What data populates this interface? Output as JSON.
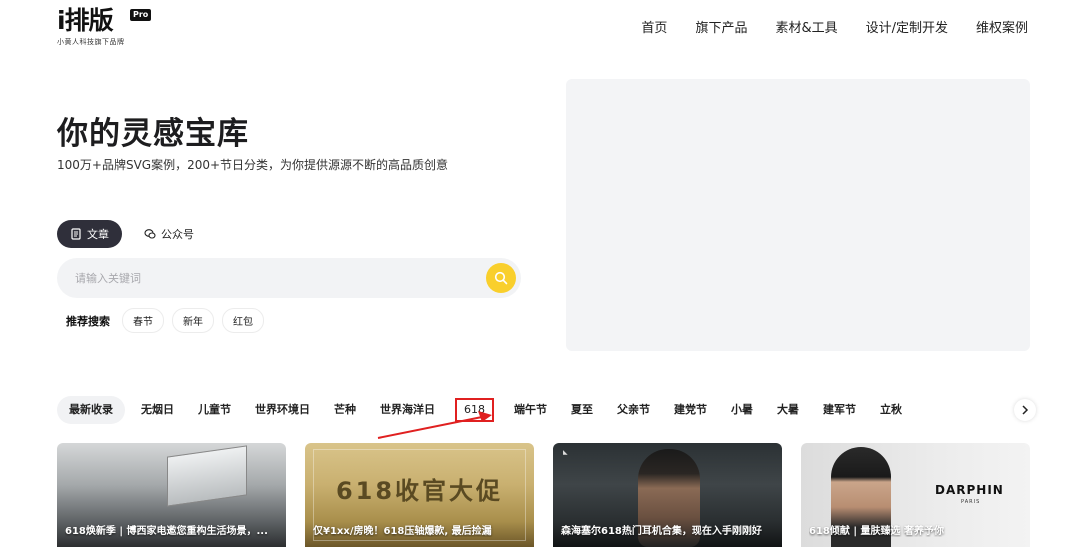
{
  "header": {
    "logo_main": "i排版",
    "logo_pro": "Pro",
    "logo_sub": "小黄人科技旗下品牌",
    "nav": [
      "首页",
      "旗下产品",
      "素材&工具",
      "设计/定制开发",
      "维权案例"
    ]
  },
  "hero": {
    "title": "你的灵感宝库",
    "subtitle": "100万+品牌SVG案例，200+节日分类，为你提供源源不断的高品质创意"
  },
  "search": {
    "tab_article": "文章",
    "tab_account": "公众号",
    "placeholder": "请输入关键词",
    "hot_label": "推荐搜索",
    "hot_tags": [
      "春节",
      "新年",
      "红包"
    ]
  },
  "categories": [
    "最新收录",
    "无烟日",
    "儿童节",
    "世界环境日",
    "芒种",
    "世界海洋日",
    "618",
    "端午节",
    "夏至",
    "父亲节",
    "建党节",
    "小暑",
    "大暑",
    "建军节",
    "立秋"
  ],
  "cards": [
    {
      "title": "618焕新季 | 博西家电邀您重构生活场景，..."
    },
    {
      "title": "仅¥1xx/房晚！618压轴爆款, 最后捡漏",
      "overlay_text": "618收官大促"
    },
    {
      "title": "森海塞尔618热门耳机合集，现在入手刚刚好"
    },
    {
      "title": "618倾献 | 量肤臻选 奢养予你",
      "brand": "DARPHIN",
      "brand_sub": "PARIS"
    }
  ],
  "colors": {
    "accent_yellow": "#f9cf2c",
    "tab_active_bg": "#2f2f3a",
    "highlight_red": "#e02020"
  }
}
